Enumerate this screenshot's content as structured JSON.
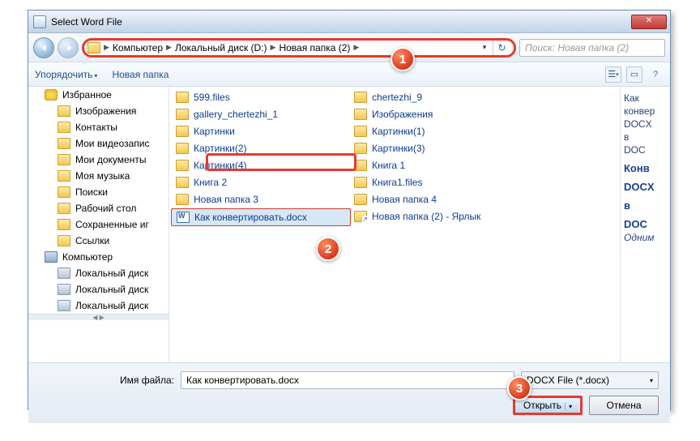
{
  "title": "Select Word File",
  "breadcrumb": {
    "items": [
      "Компьютер",
      "Локальный диск (D:)",
      "Новая папка (2)"
    ]
  },
  "search": {
    "placeholder": "Поиск: Новая папка (2)"
  },
  "toolbar": {
    "organize": "Упорядочить",
    "newfolder": "Новая папка"
  },
  "sidebar": [
    {
      "label": "Избранное",
      "icon": "star",
      "lvl": 1
    },
    {
      "label": "Изображения",
      "icon": "folder",
      "lvl": 2
    },
    {
      "label": "Контакты",
      "icon": "folder",
      "lvl": 2
    },
    {
      "label": "Мои видеозапис",
      "icon": "folder",
      "lvl": 2
    },
    {
      "label": "Мои документы",
      "icon": "folder",
      "lvl": 2
    },
    {
      "label": "Моя музыка",
      "icon": "folder",
      "lvl": 2
    },
    {
      "label": "Поиски",
      "icon": "folder",
      "lvl": 2
    },
    {
      "label": "Рабочий стол",
      "icon": "folder",
      "lvl": 2
    },
    {
      "label": "Сохраненные иг",
      "icon": "folder",
      "lvl": 2
    },
    {
      "label": "Ссылки",
      "icon": "folder",
      "lvl": 2
    },
    {
      "label": "Компьютер",
      "icon": "comp",
      "lvl": 1
    },
    {
      "label": "Локальный диск",
      "icon": "drive",
      "lvl": 2
    },
    {
      "label": "Локальный диск",
      "icon": "drive",
      "lvl": 2
    },
    {
      "label": "Локальный диск",
      "icon": "drive",
      "lvl": 2
    }
  ],
  "files_col1": [
    {
      "label": "599.files",
      "icon": "folder"
    },
    {
      "label": "gallery_chertezhi_1",
      "icon": "folder"
    },
    {
      "label": "Картинки",
      "icon": "folder"
    },
    {
      "label": "Картинки(2)",
      "icon": "folder"
    },
    {
      "label": "Картинки(4)",
      "icon": "folder"
    },
    {
      "label": "Книга 2",
      "icon": "folder"
    },
    {
      "label": "Новая папка 3",
      "icon": "folder"
    },
    {
      "label": "Как конвертировать.docx",
      "icon": "word",
      "selected": true
    }
  ],
  "files_col2": [
    {
      "label": "chertezhi_9",
      "icon": "folder"
    },
    {
      "label": "Изображения",
      "icon": "folder"
    },
    {
      "label": "Картинки(1)",
      "icon": "folder"
    },
    {
      "label": "Картинки(3)",
      "icon": "folder"
    },
    {
      "label": "Книга 1",
      "icon": "folder"
    },
    {
      "label": "Книга1.files",
      "icon": "folder"
    },
    {
      "label": "Новая папка 4",
      "icon": "folder"
    },
    {
      "label": "Новая папка (2) - Ярлык",
      "icon": "link"
    }
  ],
  "preview": {
    "lines": [
      "Как",
      "конвер",
      "DOCX",
      "в",
      "DOC"
    ],
    "bold": [
      "Конв",
      "DOCX",
      "в",
      "DOC"
    ],
    "italic": "Одним"
  },
  "file_label": "Имя файла:",
  "file_value": "Как конвертировать.docx",
  "file_type": "DOCX File (*.docx)",
  "open": "Открыть",
  "cancel": "Отмена",
  "callouts": {
    "c1": "1",
    "c2": "2",
    "c3": "3"
  }
}
